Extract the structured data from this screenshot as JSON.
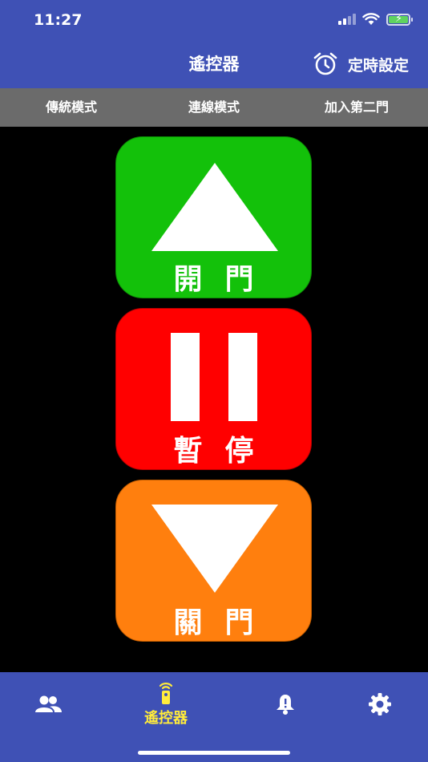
{
  "status": {
    "time": "11:27"
  },
  "header": {
    "title": "遙控器",
    "timer_label": "定時設定",
    "timer_icon": "alarm-clock-icon"
  },
  "modes": [
    "傳統模式",
    "連線模式",
    "加入第二門"
  ],
  "controls": {
    "open_label": "開門",
    "pause_label": "暫停",
    "close_label": "關門"
  },
  "nav": {
    "items": [
      {
        "icon": "people-icon",
        "label": ""
      },
      {
        "icon": "remote-icon",
        "label": "遙控器"
      },
      {
        "icon": "bell-icon",
        "label": ""
      },
      {
        "icon": "gear-icon",
        "label": ""
      }
    ]
  },
  "colors": {
    "primary": "#3f51b5",
    "mode_bar": "#6b6b6b",
    "open": "#13c10a",
    "pause": "#ff0000",
    "close": "#ff7f0e",
    "active_nav": "#ffeb3b"
  }
}
